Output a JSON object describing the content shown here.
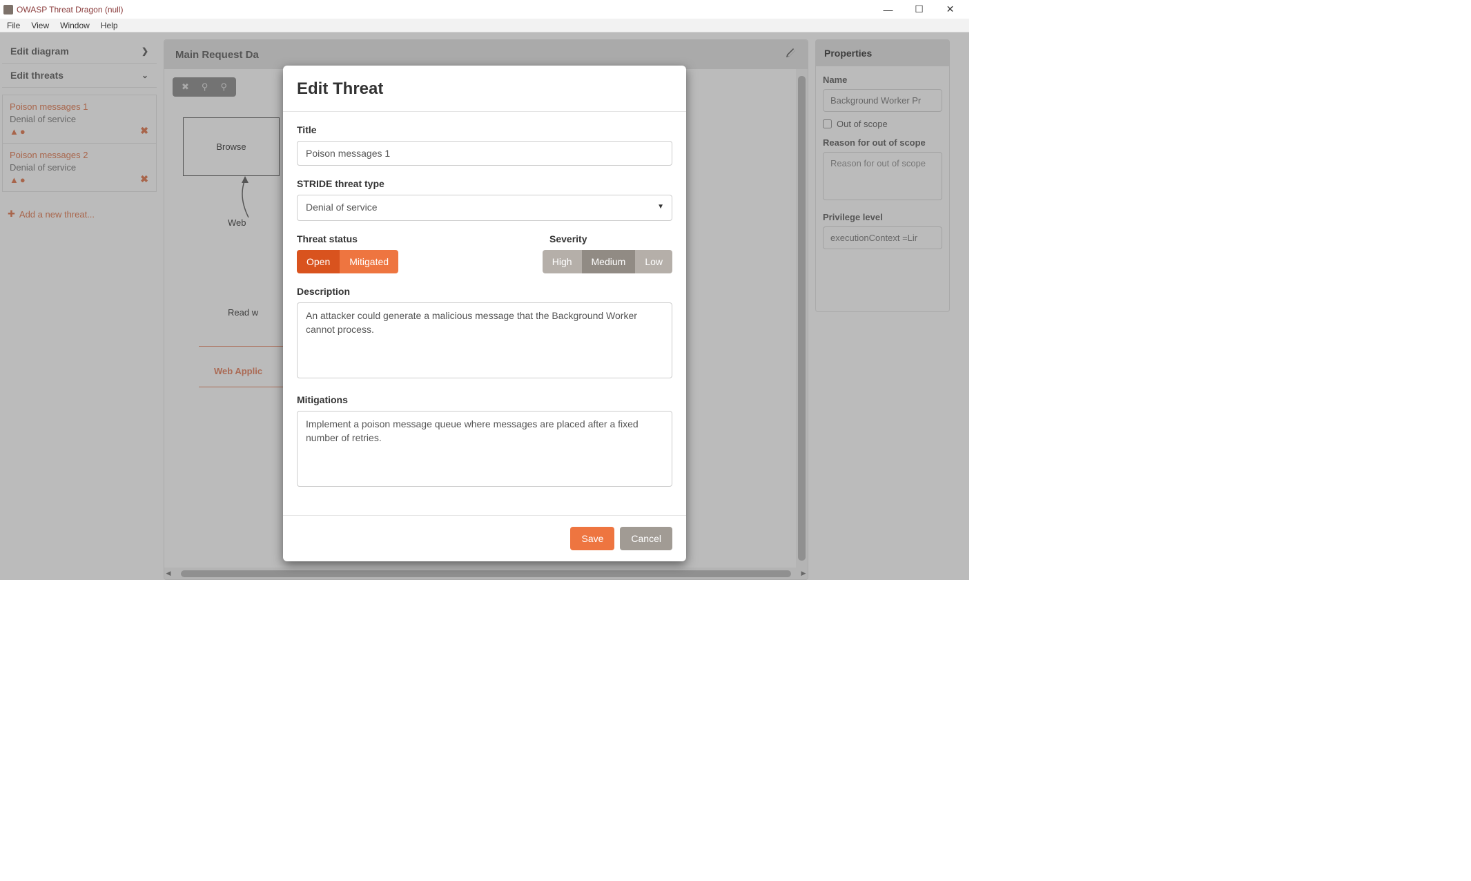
{
  "window": {
    "title": "OWASP Threat Dragon (null)"
  },
  "menu": {
    "items": [
      "File",
      "View",
      "Window",
      "Help"
    ]
  },
  "sidebar": {
    "edit_diagram": "Edit diagram",
    "edit_threats": "Edit threats",
    "threats": [
      {
        "title": "Poison messages 1",
        "sub": "Denial of service"
      },
      {
        "title": "Poison messages 2",
        "sub": "Denial of service"
      }
    ],
    "add_threat": "Add a new threat..."
  },
  "canvas": {
    "title": "Main Request Da",
    "box": "Browse",
    "arrow_label": "Web",
    "flow_label": "Read w",
    "red_text": "Web Applic"
  },
  "properties": {
    "header": "Properties",
    "labels": {
      "name": "Name",
      "out_of_scope": "Out of scope",
      "reason": "Reason for out of scope",
      "privilege": "Privilege level"
    },
    "values": {
      "name": "Background Worker Pr",
      "reason_placeholder": "Reason for out of scope",
      "privilege": "executionContext =Lir"
    }
  },
  "modal": {
    "title": "Edit Threat",
    "labels": {
      "title": "Title",
      "stride": "STRIDE threat type",
      "status": "Threat status",
      "severity": "Severity",
      "description": "Description",
      "mitigations": "Mitigations"
    },
    "values": {
      "title": "Poison messages 1",
      "stride": "Denial of service",
      "description": "An attacker could generate a malicious message that the Background Worker cannot process.",
      "mitigations": "Implement a poison message queue where messages are placed after a fixed number of retries."
    },
    "status_options": {
      "open": "Open",
      "mitigated": "Mitigated"
    },
    "severity_options": {
      "high": "High",
      "medium": "Medium",
      "low": "Low"
    },
    "buttons": {
      "save": "Save",
      "cancel": "Cancel"
    }
  }
}
